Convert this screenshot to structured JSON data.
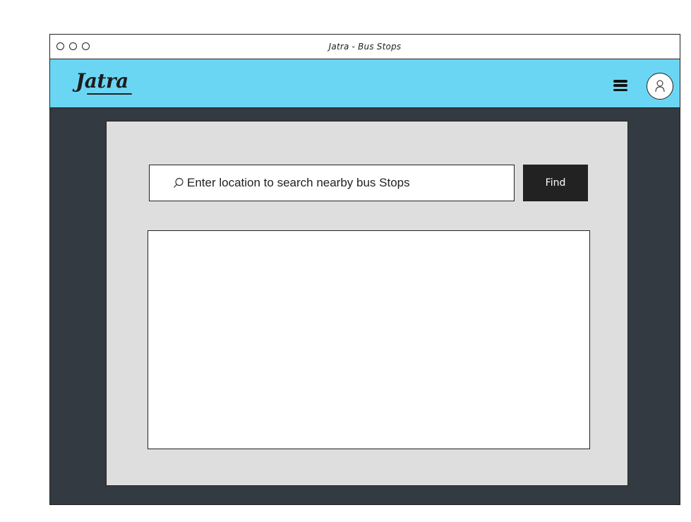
{
  "window": {
    "title": "Jatra - Bus Stops"
  },
  "header": {
    "logo_text": "Jatra",
    "menu_icon": "hamburger-menu-icon",
    "profile_icon": "user-avatar-icon",
    "background_color": "#6bd6f4"
  },
  "search": {
    "placeholder": "Enter location to search nearby bus Stops",
    "value": "",
    "icon": "search-icon",
    "button_label": "Find"
  },
  "colors": {
    "content_background": "#343a42",
    "panel_background": "#dedede",
    "button_background": "#222222"
  }
}
